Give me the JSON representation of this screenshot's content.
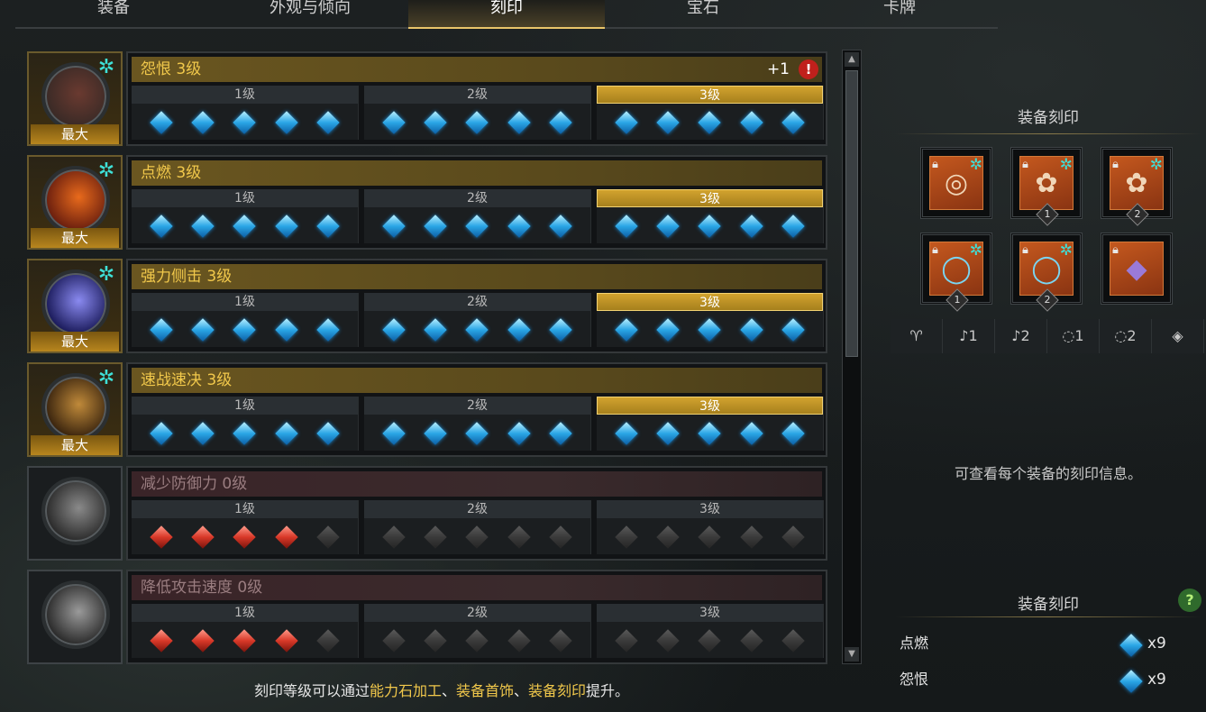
{
  "tabs": [
    {
      "label": "装备",
      "active": false
    },
    {
      "label": "外观与倾向",
      "active": false
    },
    {
      "label": "刻印",
      "active": true
    },
    {
      "label": "宝石",
      "active": false
    },
    {
      "label": "卡牌",
      "active": false
    }
  ],
  "max_label": "最大",
  "level_labels": [
    "1级",
    "2级",
    "3级"
  ],
  "engravings": [
    {
      "name": "怨恨 3级",
      "maxed": true,
      "plus": "+1",
      "alert": "!",
      "current_level": 3,
      "gem_color": "blue",
      "filled": 15,
      "orb_colors": [
        "#3a2a26",
        "#6a3a30"
      ]
    },
    {
      "name": "点燃 3级",
      "maxed": true,
      "plus": "",
      "alert": "",
      "current_level": 3,
      "gem_color": "blue",
      "filled": 15,
      "orb_colors": [
        "#6a1e0e",
        "#e86a1c"
      ]
    },
    {
      "name": "强力侧击 3级",
      "maxed": true,
      "plus": "",
      "alert": "",
      "current_level": 3,
      "gem_color": "blue",
      "filled": 15,
      "orb_colors": [
        "#1a1a5a",
        "#8a8af0"
      ]
    },
    {
      "name": "速战速决 3级",
      "maxed": true,
      "plus": "",
      "alert": "",
      "current_level": 3,
      "gem_color": "blue",
      "filled": 15,
      "orb_colors": [
        "#3a240e",
        "#c08a3a"
      ]
    },
    {
      "name": "减少防御力 0级",
      "maxed": false,
      "plus": "",
      "alert": "",
      "current_level": 0,
      "gem_color": "red",
      "filled": 4,
      "orb_colors": [
        "#2a2a2a",
        "#8a8a8a"
      ]
    },
    {
      "name": "降低攻击速度 0级",
      "maxed": false,
      "plus": "",
      "alert": "",
      "current_level": 0,
      "gem_color": "red",
      "filled": 4,
      "orb_colors": [
        "#2a2a2a",
        "#9a9a9a"
      ]
    }
  ],
  "right_panel": {
    "title": "装备刻印",
    "slots": [
      {
        "name": "necklace",
        "badge": ""
      },
      {
        "name": "earring-1",
        "badge": "1"
      },
      {
        "name": "earring-2",
        "badge": "2"
      },
      {
        "name": "ring-1",
        "badge": "1"
      },
      {
        "name": "ring-2",
        "badge": "2"
      },
      {
        "name": "stone",
        "badge": ""
      }
    ],
    "filters": [
      {
        "glyph": "♈︎",
        "icon": "necklace-icon"
      },
      {
        "glyph": "♪1",
        "icon": "earring-1-icon"
      },
      {
        "glyph": "♪2",
        "icon": "earring-2-icon"
      },
      {
        "glyph": "◌1",
        "icon": "ring-1-icon"
      },
      {
        "glyph": "◌2",
        "icon": "ring-2-icon"
      },
      {
        "glyph": "◈",
        "icon": "stone-icon"
      }
    ],
    "info": "可查看每个装备的刻印信息。",
    "summary_title": "装备刻印",
    "help": "?",
    "summary": [
      {
        "name": "点燃",
        "count": "x9"
      },
      {
        "name": "怨恨",
        "count": "x9"
      }
    ]
  },
  "footer": {
    "prefix": "刻印等级可以通过",
    "hl1": "能力石加工",
    "sep1": "、",
    "hl2": "装备首饰",
    "sep2": "、",
    "hl3": "装备刻印",
    "suffix": "提升。"
  },
  "scroll": {
    "up": "▲",
    "down": "▼"
  }
}
